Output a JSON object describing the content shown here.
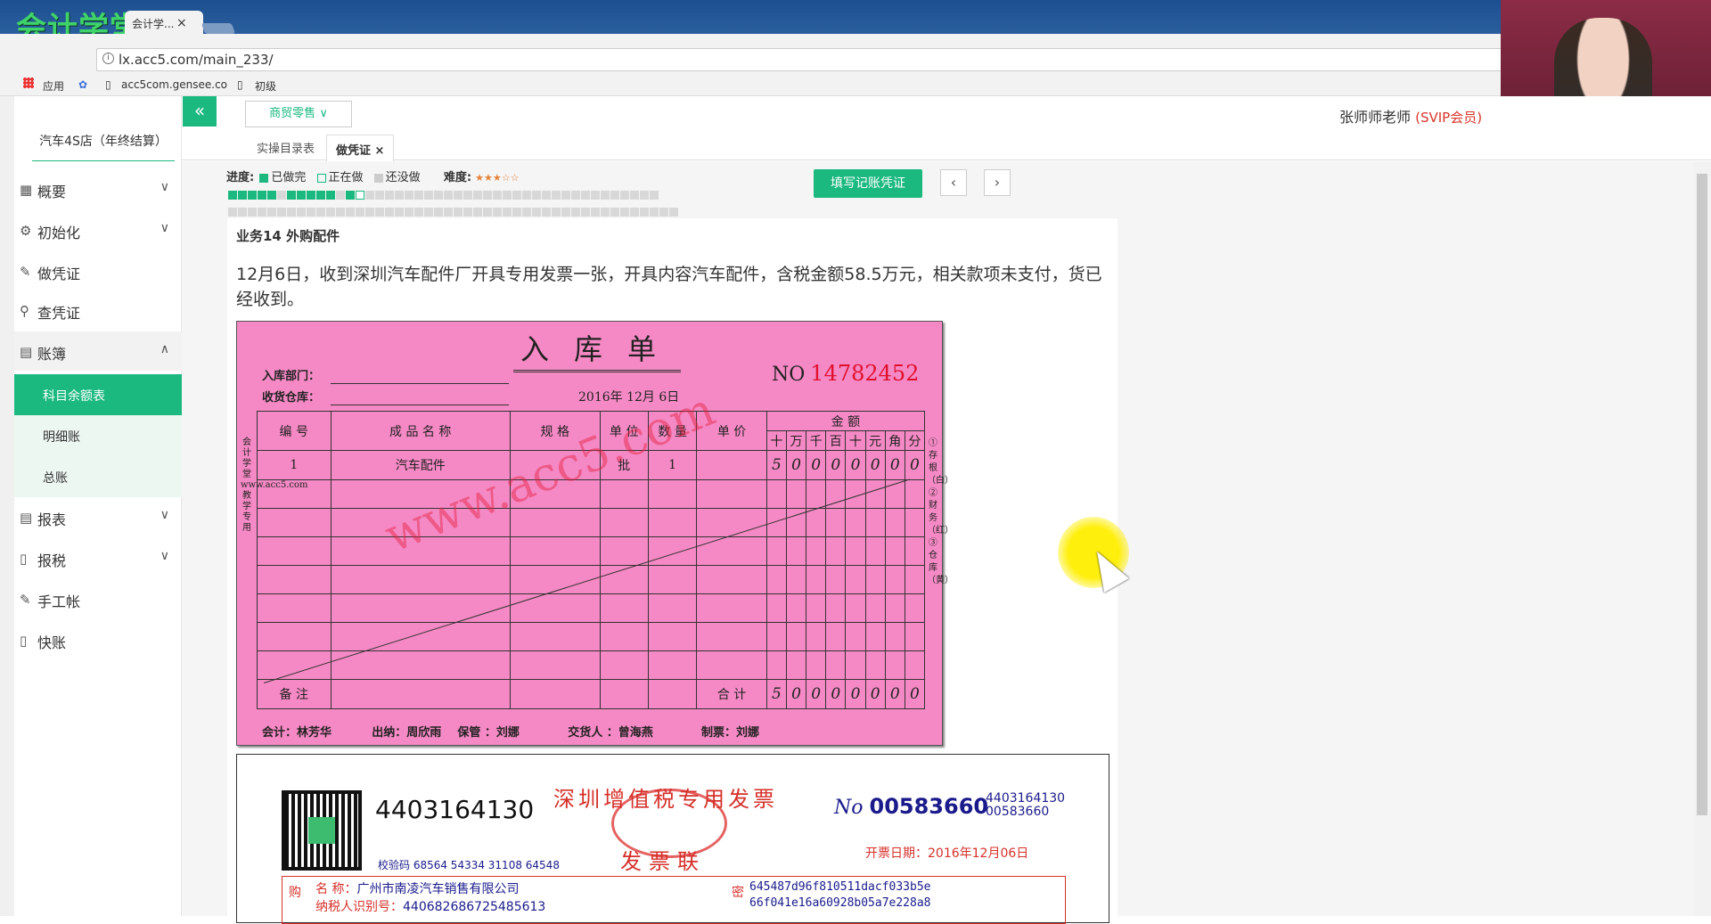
{
  "browser": {
    "logo": "会计学堂",
    "tab_title": "会计学...",
    "tab_close": "×",
    "url": "lx.acc5.com/main_233/",
    "bookmarks": [
      "应用",
      "acc5com.gensee.co",
      "初级"
    ]
  },
  "header": {
    "industry": "商贸零售",
    "user_name": "张师师老师",
    "vip": "(SVIP会员)"
  },
  "sidebar": {
    "collapse_icon": "«",
    "company": "汽车4S店（年终结算）",
    "items": [
      {
        "label": "概要",
        "icon": "grid-icon",
        "chevron": "∨"
      },
      {
        "label": "初始化",
        "icon": "gear-icon",
        "chevron": "∨"
      },
      {
        "label": "做凭证",
        "icon": "pen-icon"
      },
      {
        "label": "查凭证",
        "icon": "search-icon"
      },
      {
        "label": "账簿",
        "icon": "book-icon",
        "chevron": "∧"
      },
      {
        "label": "报表",
        "icon": "report-icon",
        "chevron": "∨"
      },
      {
        "label": "报税",
        "icon": "file-icon",
        "chevron": "∨"
      },
      {
        "label": "手工帐",
        "icon": "pen-icon"
      },
      {
        "label": "快账",
        "icon": "file-icon"
      }
    ],
    "subitems": [
      "科目余额表",
      "明细账",
      "总账"
    ]
  },
  "tabs": [
    "实操目录表",
    "做凭证"
  ],
  "tab_close": "×",
  "progress": {
    "label": "进度:",
    "done": "已做完",
    "doing": "正在做",
    "todo": "还没做",
    "difficulty": "难度:",
    "stars": "★★★☆☆",
    "states": [
      "d",
      "d",
      "d",
      "d",
      "d",
      "t",
      "d",
      "d",
      "d",
      "d",
      "d",
      "t",
      "d",
      "i",
      "t",
      "t",
      "t",
      "t",
      "t",
      "t",
      "t",
      "t",
      "t",
      "t",
      "t",
      "t",
      "t",
      "t",
      "t",
      "t",
      "t",
      "t",
      "t",
      "t",
      "t",
      "t",
      "t",
      "t",
      "t",
      "t",
      "t",
      "t",
      "t",
      "t",
      "t",
      "t",
      "t",
      "t",
      "t",
      "t",
      "t",
      "t",
      "t",
      "t",
      "t",
      "t",
      "t",
      "t",
      "t",
      "t",
      "t",
      "t",
      "t",
      "t",
      "t",
      "t",
      "t",
      "t",
      "t",
      "t",
      "t",
      "t",
      "t",
      "t",
      "t",
      "t",
      "t",
      "t",
      "t",
      "t",
      "t",
      "t",
      "t",
      "t",
      "t",
      "t",
      "t",
      "t",
      "t",
      "t"
    ]
  },
  "fill_button": "填写记账凭证",
  "prev": "‹",
  "next": "›",
  "business": {
    "title": "业务14 外购配件",
    "description": "12月6日，收到深圳汽车配件厂开具专用发票一张，开具内容汽车配件，含税金额58.5万元，相关款项未支付，货已经收到。"
  },
  "receipt": {
    "title": "入库单",
    "no_label": "NO",
    "no": "14782452",
    "dept_label": "入库部门：",
    "warehouse_label": "收货仓库：",
    "date": "2016年 12月 6日",
    "headers": [
      "编 号",
      "成 品 名 称",
      "规 格",
      "单 位",
      "数 量",
      "单 价",
      "金  额"
    ],
    "amount_units": [
      "十",
      "万",
      "千",
      "百",
      "十",
      "元",
      "角",
      "分"
    ],
    "row": {
      "no": "1",
      "name": "汽车配件",
      "unit": "批",
      "qty": "1",
      "amount": [
        "5",
        "0",
        "0",
        "0",
        "0",
        "0",
        "0",
        "0"
      ]
    },
    "remark_label": "备 注",
    "total_label": "合 计",
    "total": [
      "5",
      "0",
      "0",
      "0",
      "0",
      "0",
      "0",
      "0"
    ],
    "side_left": "会计学堂www.acc5.com教学专用",
    "side_right": "①存根（白）②财务（红）③仓库（黄）",
    "watermark": "www.acc5.com",
    "footer": "会计：林芳华          出纳：周欣雨    保管 ：刘娜            交货人 ：曾海燕            制票：刘娜"
  },
  "invoice": {
    "code": "4403164130",
    "title": "深圳增值税专用发票",
    "sub": "发票联",
    "no_label": "No",
    "no": "00583660",
    "no_small_1": "4403164130",
    "no_small_2": "00583660",
    "date_label": "开票日期：2016年12月06日",
    "check_code": "校验码 68564 54334 31108 64548",
    "buyer_name_label": "名          称：",
    "buyer_name": "广州市南凌汽车销售有限公司",
    "buyer_tax_label": "纳税人识别号：",
    "buyer_tax": "440682686725485613",
    "buyer_side": "购",
    "pw_side": "密",
    "pw1": "645487d96f810511dacf033b5e",
    "pw2": "66f041e16a60928b05a7e228a8"
  }
}
